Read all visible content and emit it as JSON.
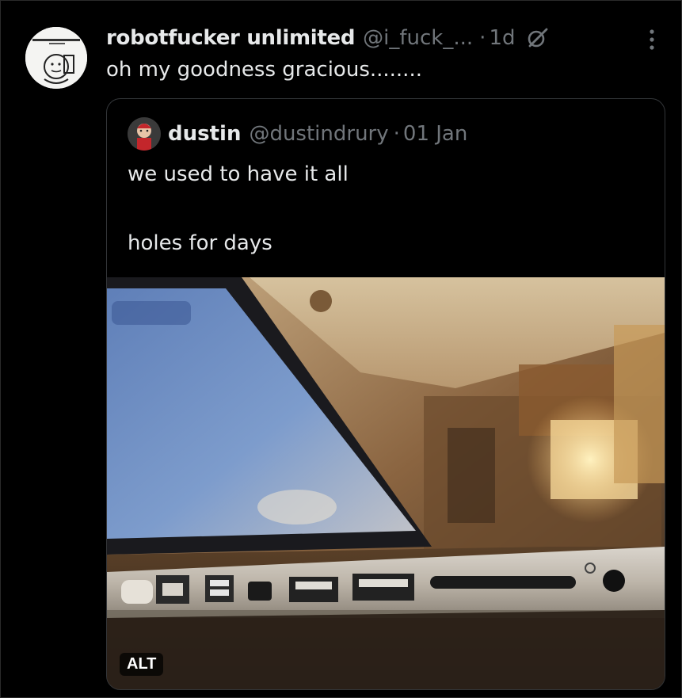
{
  "post": {
    "display_name": "robotfucker unlimited",
    "handle": "@i_fuck_...",
    "separator": "·",
    "timestamp": "1d",
    "text": "oh my goodness gracious........",
    "icons": {
      "avatar": "cartoon-avatar",
      "grok": "grok-icon",
      "more": "more-options-icon"
    },
    "quoted": {
      "display_name": "dustin",
      "handle": "@dustindrury",
      "separator": "·",
      "timestamp": "01 Jan",
      "line1": "we used to have it all",
      "line2": "holes for days",
      "media": {
        "alt_label": "ALT",
        "description_icon": "laptop-ports-photo"
      }
    }
  },
  "colors": {
    "background": "#000000",
    "text_primary": "#e7e9ea",
    "text_secondary": "#71767b",
    "border": "#333639"
  }
}
